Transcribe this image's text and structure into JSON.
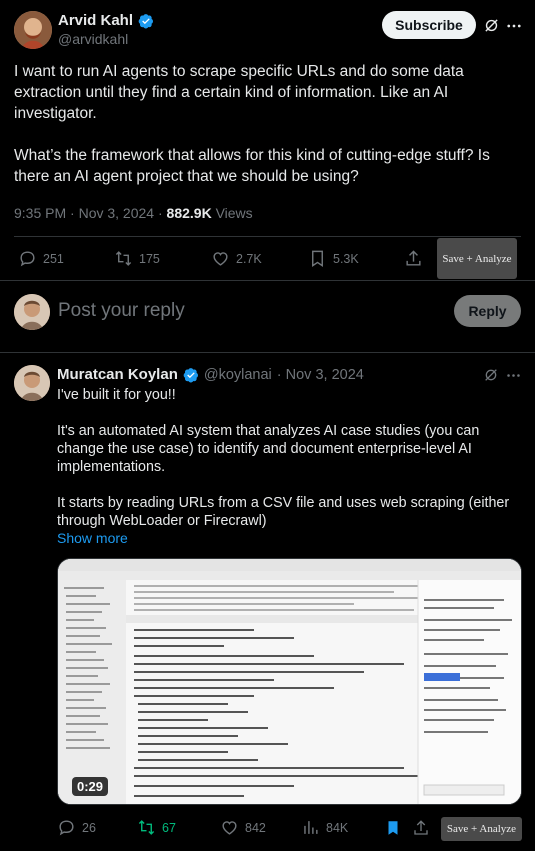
{
  "tweet": {
    "author_name": "Arvid Kahl",
    "author_handle": "@arvidkahl",
    "subscribe_label": "Subscribe",
    "text": "I want to run AI agents to scrape specific URLs and do some data extraction until they find a certain kind of information. Like an AI investigator.\n\nWhat’s the framework that allows for this kind of cutting-edge stuff? Is there an AI agent project that we should be using?",
    "time": "9:35 PM · Nov 3, 2024 ·",
    "views_count": "882.9K",
    "views_label": "Views",
    "stats": {
      "replies": "251",
      "reposts": "175",
      "likes": "2.7K",
      "bookmarks": "5.3K"
    },
    "save_label": "Save + Analyze"
  },
  "composer": {
    "placeholder": "Post your reply",
    "reply_label": "Reply"
  },
  "reply": {
    "author_name": "Muratcan Koylan",
    "author_handle": "@koylanai",
    "date": "· Nov 3, 2024",
    "text": "I've built it for you!!\n\nIt's an automated AI system that analyzes AI case studies (you can change the use case) to identify and document enterprise-level AI implementations.\n\nIt starts by reading URLs from a CSV file and uses web scraping (either through WebLoader or Firecrawl)",
    "show_more": "Show more",
    "video_duration": "0:29",
    "stats": {
      "replies": "26",
      "reposts": "67",
      "likes": "842",
      "views": "84K"
    },
    "save_label": "Save + Analyze"
  },
  "colors": {
    "background": "#000000",
    "text": "#e7e9ea",
    "muted": "#71767b",
    "accent": "#1d9bf0",
    "verified": "#1d9bf0",
    "repost_active": "#00ba7c",
    "divider": "#2f3336"
  },
  "icons": [
    "verified-icon",
    "grok-icon",
    "more-icon",
    "reply-icon",
    "repost-icon",
    "like-icon",
    "bookmark-icon",
    "share-icon",
    "views-icon"
  ]
}
